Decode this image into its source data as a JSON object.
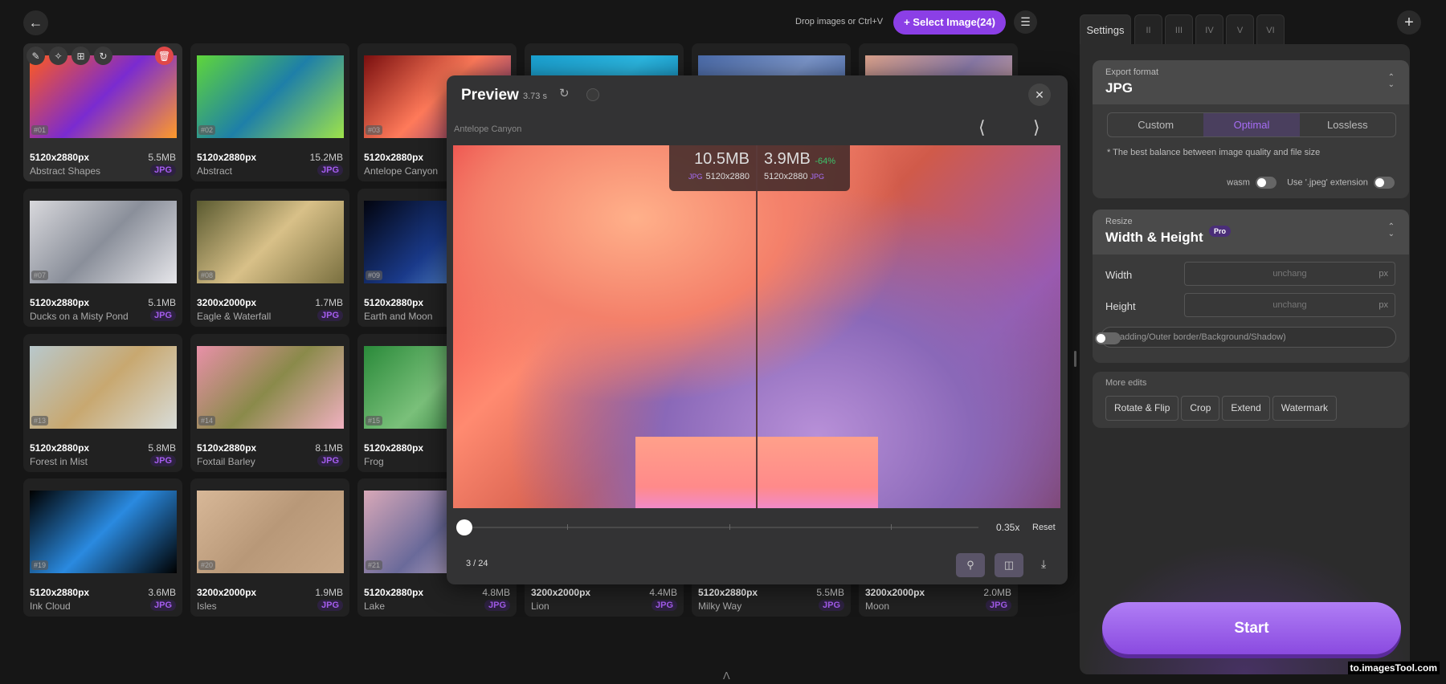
{
  "header": {
    "drop_hint": "Drop images or Ctrl+V",
    "select_label": "+ Select Image(24)"
  },
  "cards": [
    {
      "index": "#01",
      "dims": "5120x2880px",
      "size": "5.5MB",
      "name": "Abstract Shapes",
      "format": "JPG",
      "colors": [
        "#ff5a1f",
        "#7a2bd0",
        "#ff9a2a"
      ]
    },
    {
      "index": "#02",
      "dims": "5120x2880px",
      "size": "15.2MB",
      "name": "Abstract",
      "format": "JPG",
      "colors": [
        "#5fd63a",
        "#1e7fa8",
        "#9ee34a"
      ]
    },
    {
      "index": "#03",
      "dims": "5120x2880px",
      "size": "",
      "name": "Antelope Canyon",
      "format": "",
      "colors": [
        "#7a0f0f",
        "#ff7a5a",
        "#5a2a7a"
      ]
    },
    {
      "index": "",
      "dims": "",
      "size": "",
      "name": "",
      "format": "",
      "colors": [
        "#1aa0d0",
        "#2bb6e0",
        "#0e7fb0"
      ]
    },
    {
      "index": "",
      "dims": "",
      "size": "",
      "name": "",
      "format": "",
      "colors": [
        "#4a6aa8",
        "#7a94c8",
        "#3a5a98"
      ]
    },
    {
      "index": "",
      "dims": "",
      "size": "",
      "name": "",
      "format": "",
      "colors": [
        "#d9a08a",
        "#8a7aa8",
        "#e8b09a"
      ]
    },
    {
      "index": "#07",
      "dims": "5120x2880px",
      "size": "5.1MB",
      "name": "Ducks on a Misty Pond",
      "format": "JPG",
      "colors": [
        "#d8d8dc",
        "#8a8f9a",
        "#e6e6ea"
      ]
    },
    {
      "index": "#08",
      "dims": "3200x2000px",
      "size": "1.7MB",
      "name": "Eagle & Waterfall",
      "format": "JPG",
      "colors": [
        "#5a5a30",
        "#d8c088",
        "#7a7040"
      ]
    },
    {
      "index": "#09",
      "dims": "5120x2880px",
      "size": "",
      "name": "Earth and Moon",
      "format": "",
      "colors": [
        "#02040e",
        "#1a3a8a",
        "#7ab8f0"
      ]
    },
    {
      "index": "",
      "dims": "",
      "size": "",
      "name": "",
      "format": "",
      "colors": [
        "#333",
        "#333",
        "#333"
      ]
    },
    {
      "index": "",
      "dims": "",
      "size": "",
      "name": "",
      "format": "",
      "colors": [
        "#333",
        "#333",
        "#333"
      ]
    },
    {
      "index": "",
      "dims": "",
      "size": "",
      "name": "",
      "format": "",
      "colors": [
        "#333",
        "#333",
        "#333"
      ]
    },
    {
      "index": "#13",
      "dims": "5120x2880px",
      "size": "5.8MB",
      "name": "Forest in Mist",
      "format": "JPG",
      "colors": [
        "#b8c8cc",
        "#c8a870",
        "#d8dcd8"
      ]
    },
    {
      "index": "#14",
      "dims": "5120x2880px",
      "size": "8.1MB",
      "name": "Foxtail Barley",
      "format": "JPG",
      "colors": [
        "#e890a8",
        "#8a8a4a",
        "#f0b0c0"
      ]
    },
    {
      "index": "#15",
      "dims": "5120x2880px",
      "size": "",
      "name": "Frog",
      "format": "",
      "colors": [
        "#2a8a3a",
        "#7ac07a",
        "#1a6a2a"
      ]
    },
    {
      "index": "",
      "dims": "",
      "size": "",
      "name": "",
      "format": "",
      "colors": [
        "#333",
        "#333",
        "#333"
      ]
    },
    {
      "index": "",
      "dims": "",
      "size": "",
      "name": "",
      "format": "",
      "colors": [
        "#333",
        "#333",
        "#333"
      ]
    },
    {
      "index": "",
      "dims": "",
      "size": "",
      "name": "",
      "format": "",
      "colors": [
        "#333",
        "#333",
        "#333"
      ]
    },
    {
      "index": "#19",
      "dims": "5120x2880px",
      "size": "3.6MB",
      "name": "Ink Cloud",
      "format": "JPG",
      "colors": [
        "#000",
        "#2a8ae0",
        "#000"
      ]
    },
    {
      "index": "#20",
      "dims": "3200x2000px",
      "size": "1.9MB",
      "name": "Isles",
      "format": "JPG",
      "colors": [
        "#d8b898",
        "#b89878",
        "#c8a888"
      ]
    },
    {
      "index": "#21",
      "dims": "5120x2880px",
      "size": "4.8MB",
      "name": "Lake",
      "format": "JPG",
      "colors": [
        "#d8a8b8",
        "#6a6a9a",
        "#e8c8d8"
      ]
    },
    {
      "index": "",
      "dims": "3200x2000px",
      "size": "4.4MB",
      "name": "Lion",
      "format": "JPG",
      "colors": [
        "#333",
        "#333",
        "#333"
      ]
    },
    {
      "index": "",
      "dims": "5120x2880px",
      "size": "5.5MB",
      "name": "Milky Way",
      "format": "JPG",
      "colors": [
        "#333",
        "#333",
        "#333"
      ]
    },
    {
      "index": "",
      "dims": "3200x2000px",
      "size": "2.0MB",
      "name": "Moon",
      "format": "JPG",
      "colors": [
        "#333",
        "#333",
        "#333"
      ]
    }
  ],
  "preview": {
    "title": "Preview",
    "time": "3.73 s",
    "image_name": "Antelope Canyon",
    "original": {
      "size": "10.5MB",
      "format": "JPG",
      "dims": "5120x2880"
    },
    "compressed": {
      "size": "3.9MB",
      "delta": "-64%",
      "dims": "5120x2880",
      "format": "JPG"
    },
    "zoom": "0.35x",
    "zoom_level": 0.0,
    "reset": "Reset",
    "counter": "3 / 24"
  },
  "settings": {
    "tabs": [
      "Settings",
      "II",
      "III",
      "IV",
      "V",
      "VI"
    ],
    "export_label": "Export format",
    "export_value": "JPG",
    "modes": [
      "Custom",
      "Optimal",
      "Lossless"
    ],
    "active_mode": "Optimal",
    "note": "* The best balance between image quality and file size",
    "wasm": "wasm",
    "jpeg_ext": "Use '.jpeg' extension",
    "resize_label": "Resize",
    "resize_value": "Width & Height",
    "pro": "Pro",
    "width_label": "Width",
    "height_label": "Height",
    "placeholder": "unchang",
    "unit": "px",
    "padding": "(Padding/Outer border/Background/Shadow)",
    "more_label": "More edits",
    "edits": [
      "Rotate & Flip",
      "Crop",
      "Extend",
      "Watermark"
    ],
    "start": "Start"
  },
  "footer": {
    "watermark": "to.imagesTool.com"
  },
  "accent": "#8b3fe6"
}
